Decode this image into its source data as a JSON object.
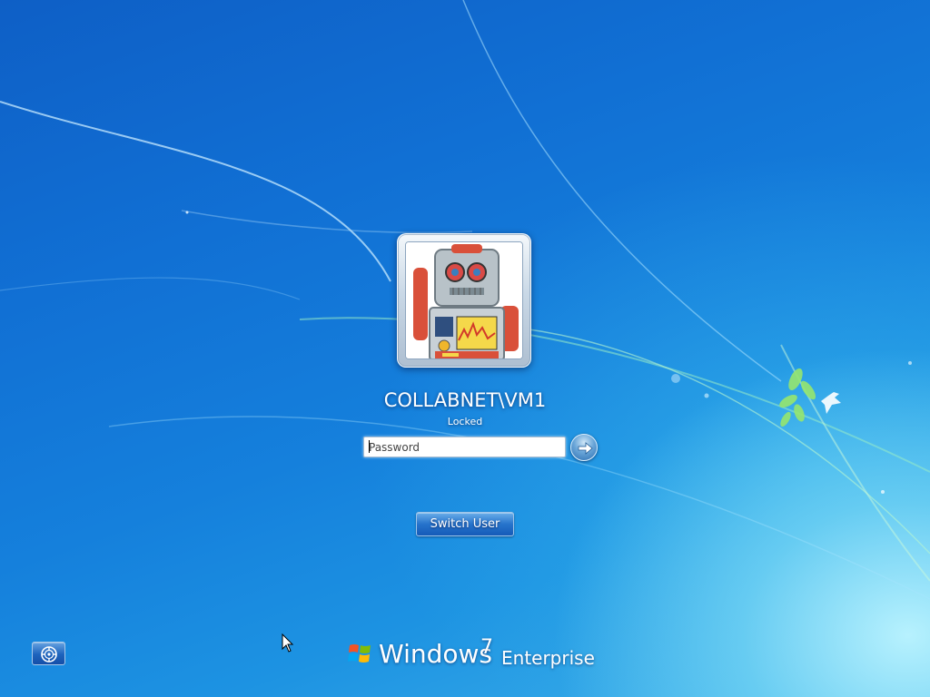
{
  "user": {
    "name": "COLLABNET\\VM1",
    "status": "Locked",
    "avatar_icon": "robot-avatar"
  },
  "password": {
    "placeholder": "Password",
    "value": ""
  },
  "buttons": {
    "submit_icon": "arrow-right-icon",
    "switch_user_label": "Switch User",
    "ease_of_access_icon": "ease-of-access-icon"
  },
  "branding": {
    "word": "Windows",
    "version": "7",
    "edition": "Enterprise"
  },
  "colors": {
    "background": "#1170d4",
    "accent": "#3fb2ea",
    "text": "#ffffff"
  }
}
